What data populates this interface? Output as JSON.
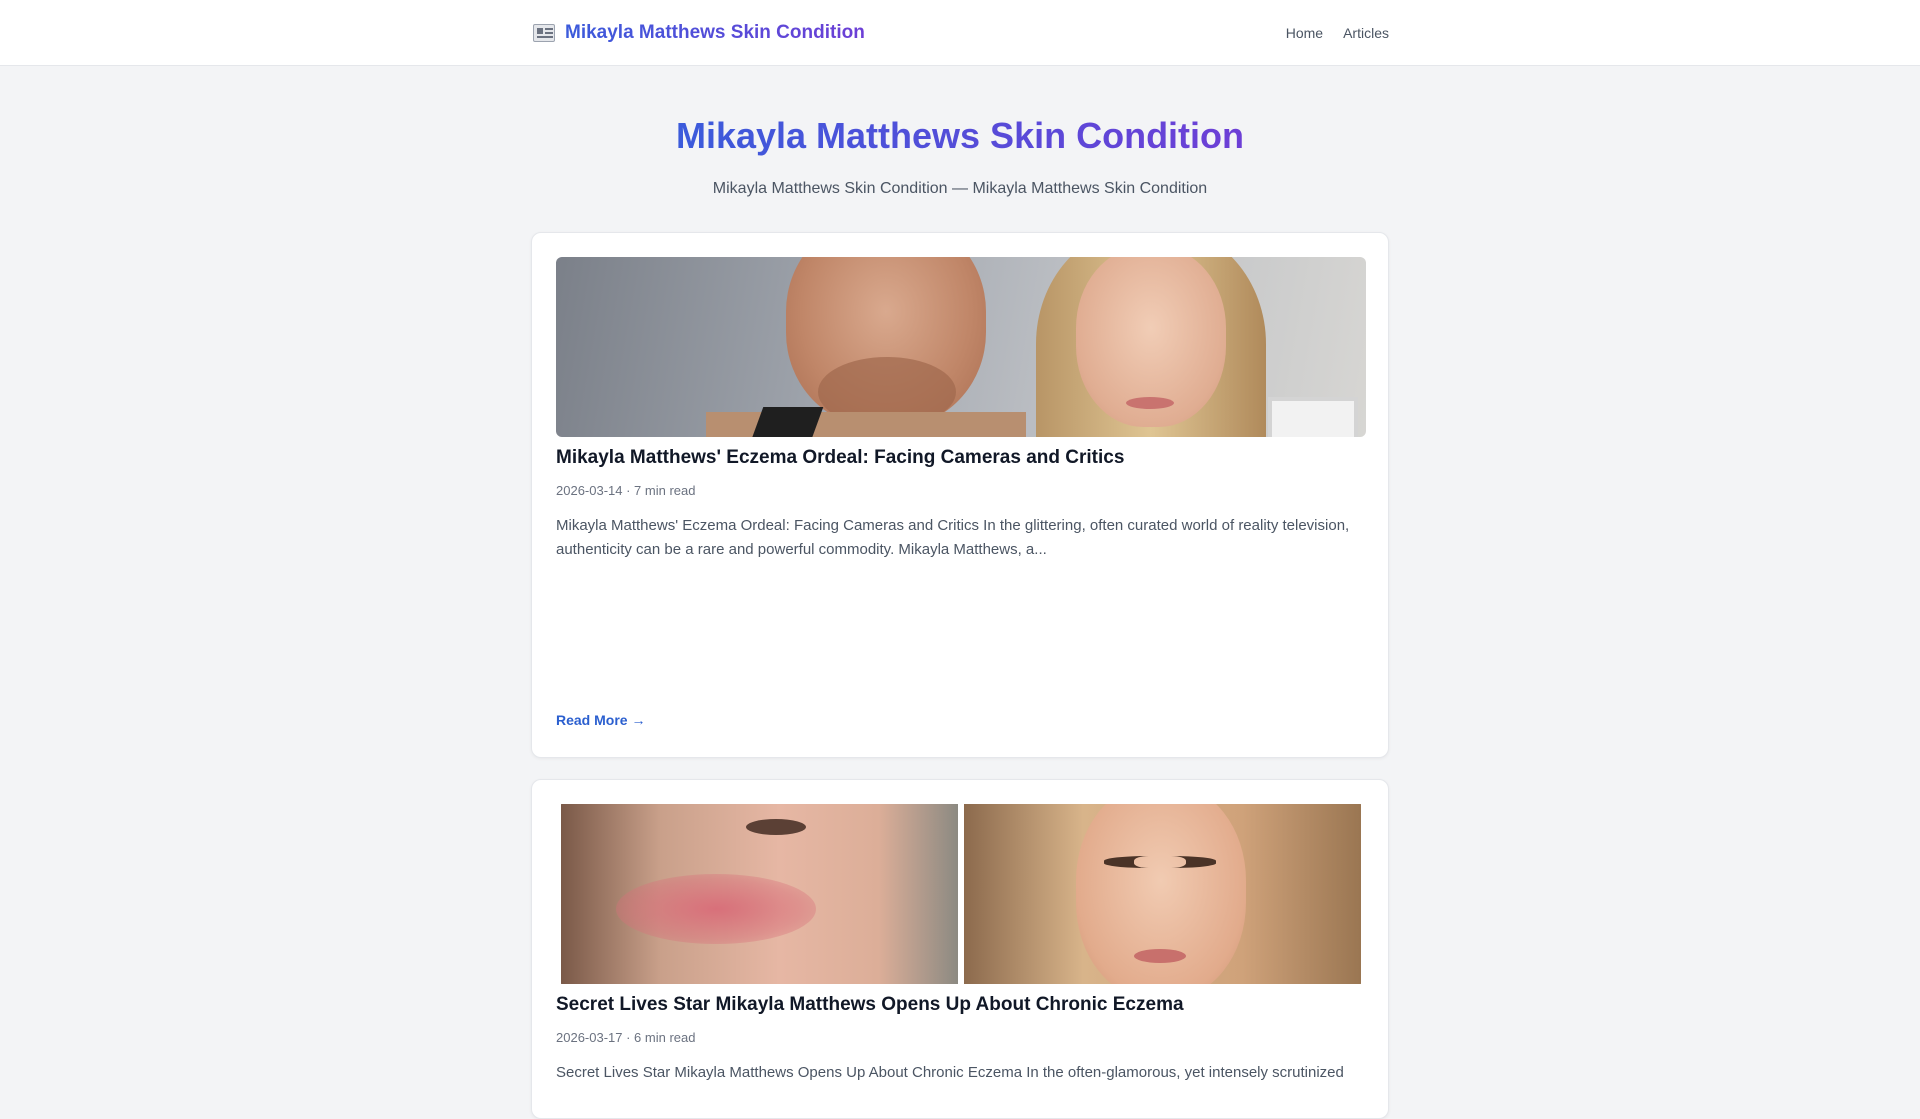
{
  "header": {
    "brand_icon": "newspaper-icon",
    "brand_title": "Mikayla Matthews Skin Condition",
    "nav": [
      {
        "label": "Home"
      },
      {
        "label": "Articles"
      }
    ]
  },
  "hero": {
    "title": "Mikayla Matthews Skin Condition",
    "subtitle": "Mikayla Matthews Skin Condition — Mikayla Matthews Skin Condition"
  },
  "articles": [
    {
      "title": "Mikayla Matthews' Eczema Ordeal: Facing Cameras and Critics",
      "meta": "2026-03-14 · 7 min read",
      "excerpt": "Mikayla Matthews' Eczema Ordeal: Facing Cameras and Critics In the glittering, often curated world of reality television, authenticity can be a rare and powerful commodity. Mikayla Matthews, a...",
      "read_more": "Read More →"
    },
    {
      "title": "Secret Lives Star Mikayla Matthews Opens Up About Chronic Eczema",
      "meta": "2026-03-17 · 6 min read",
      "excerpt": "Secret Lives Star Mikayla Matthews Opens Up About Chronic Eczema In the often-glamorous, yet intensely scrutinized"
    }
  ],
  "colors": {
    "accent_start": "#3b5bdb",
    "accent_end": "#6d3fd6",
    "link": "#2b5fcf",
    "background": "#f3f4f6"
  }
}
